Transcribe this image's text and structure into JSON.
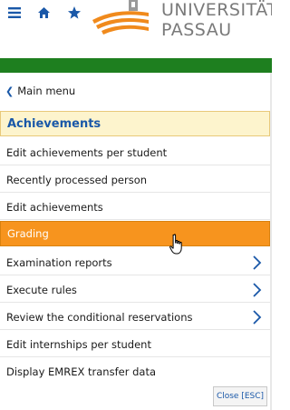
{
  "header": {
    "logo_line1": "UNIVERSITÄT",
    "logo_line2": "PASSAU",
    "icons": [
      "menu-icon",
      "home-icon",
      "star-icon"
    ],
    "accent_color": "#1e7f1f"
  },
  "menu": {
    "back_label": "Main menu",
    "section_title": "Achievements",
    "items": [
      {
        "label": "Edit achievements per student",
        "has_arrow": false,
        "active": false
      },
      {
        "label": "Recently processed person",
        "has_arrow": false,
        "active": false
      },
      {
        "label": "Edit achievements",
        "has_arrow": false,
        "active": false
      },
      {
        "label": "Grading",
        "has_arrow": false,
        "active": true
      },
      {
        "label": "Examination reports",
        "has_arrow": true,
        "active": false
      },
      {
        "label": "Execute rules",
        "has_arrow": true,
        "active": false
      },
      {
        "label": "Review the conditional reservations",
        "has_arrow": true,
        "active": false
      },
      {
        "label": "Edit internships per student",
        "has_arrow": false,
        "active": false
      },
      {
        "label": "Display EMREX transfer data",
        "has_arrow": false,
        "active": false
      }
    ]
  },
  "footer": {
    "close_label": "Close [ESC]"
  },
  "colors": {
    "link_blue": "#1a58a8",
    "active_orange": "#f7941e",
    "section_bg": "#fdf4cd"
  }
}
